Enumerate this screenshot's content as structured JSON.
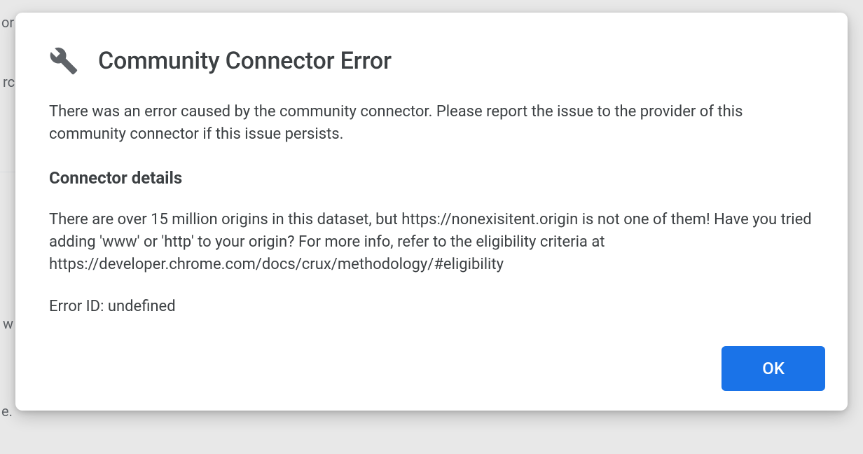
{
  "dialog": {
    "title": "Community Connector Error",
    "intro_text": "There was an error caused by the community connector. Please report the issue to the provider of this community connector if this issue persists.",
    "section_heading": "Connector details",
    "detail_text": "There are over 15 million origins in this dataset, but https://nonexisitent.origin is not one of them! Have you tried adding 'www' or 'http' to your origin? For more info, refer to the eligibility criteria at https://developer.chrome.com/docs/crux/methodology/#eligibility",
    "error_id_text": "Error ID: undefined",
    "ok_button_label": "OK"
  },
  "background": {
    "text1": "or",
    "text2": "rc",
    "text3": "w",
    "text4": "e."
  }
}
